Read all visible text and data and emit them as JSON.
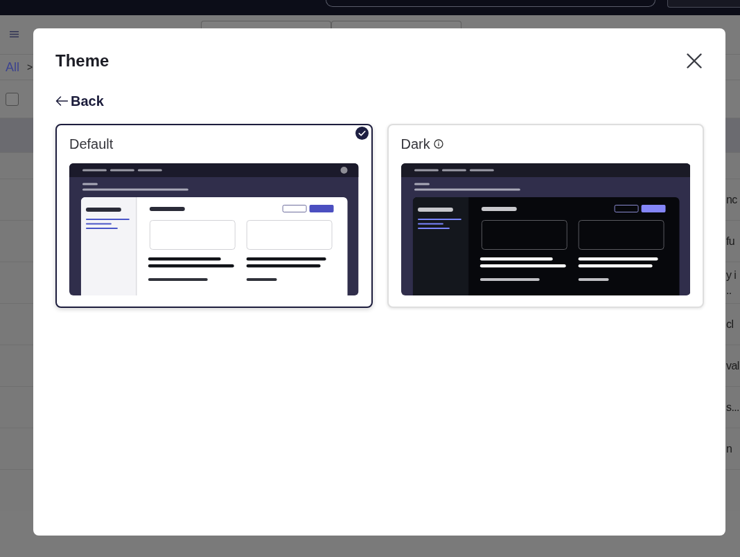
{
  "background": {
    "breadcrumb": [
      {
        "label": "All"
      }
    ],
    "breadcrumb_separator": ">",
    "header_checkbox": {
      "checked": false
    },
    "rows": [
      {
        "selected": true
      },
      {
        "selected": false
      },
      {
        "selected": false,
        "lines": [
          "nc"
        ]
      },
      {
        "selected": false,
        "lines": [
          "fu"
        ]
      },
      {
        "selected": false,
        "lines": [
          "y i",
          ".."
        ]
      },
      {
        "selected": false,
        "lines": [
          "cl"
        ]
      },
      {
        "selected": false,
        "lines": [
          "val"
        ]
      },
      {
        "selected": false,
        "lines": [
          "s..."
        ]
      },
      {
        "selected": false,
        "lines": [
          "n"
        ]
      },
      {
        "selected": false
      }
    ]
  },
  "dialog": {
    "title": "Theme",
    "back_label": "Back",
    "themes": [
      {
        "label": "Default",
        "kind": "light",
        "selected": true,
        "info": false
      },
      {
        "label": "Dark",
        "kind": "dark",
        "selected": false,
        "info": true
      }
    ]
  }
}
